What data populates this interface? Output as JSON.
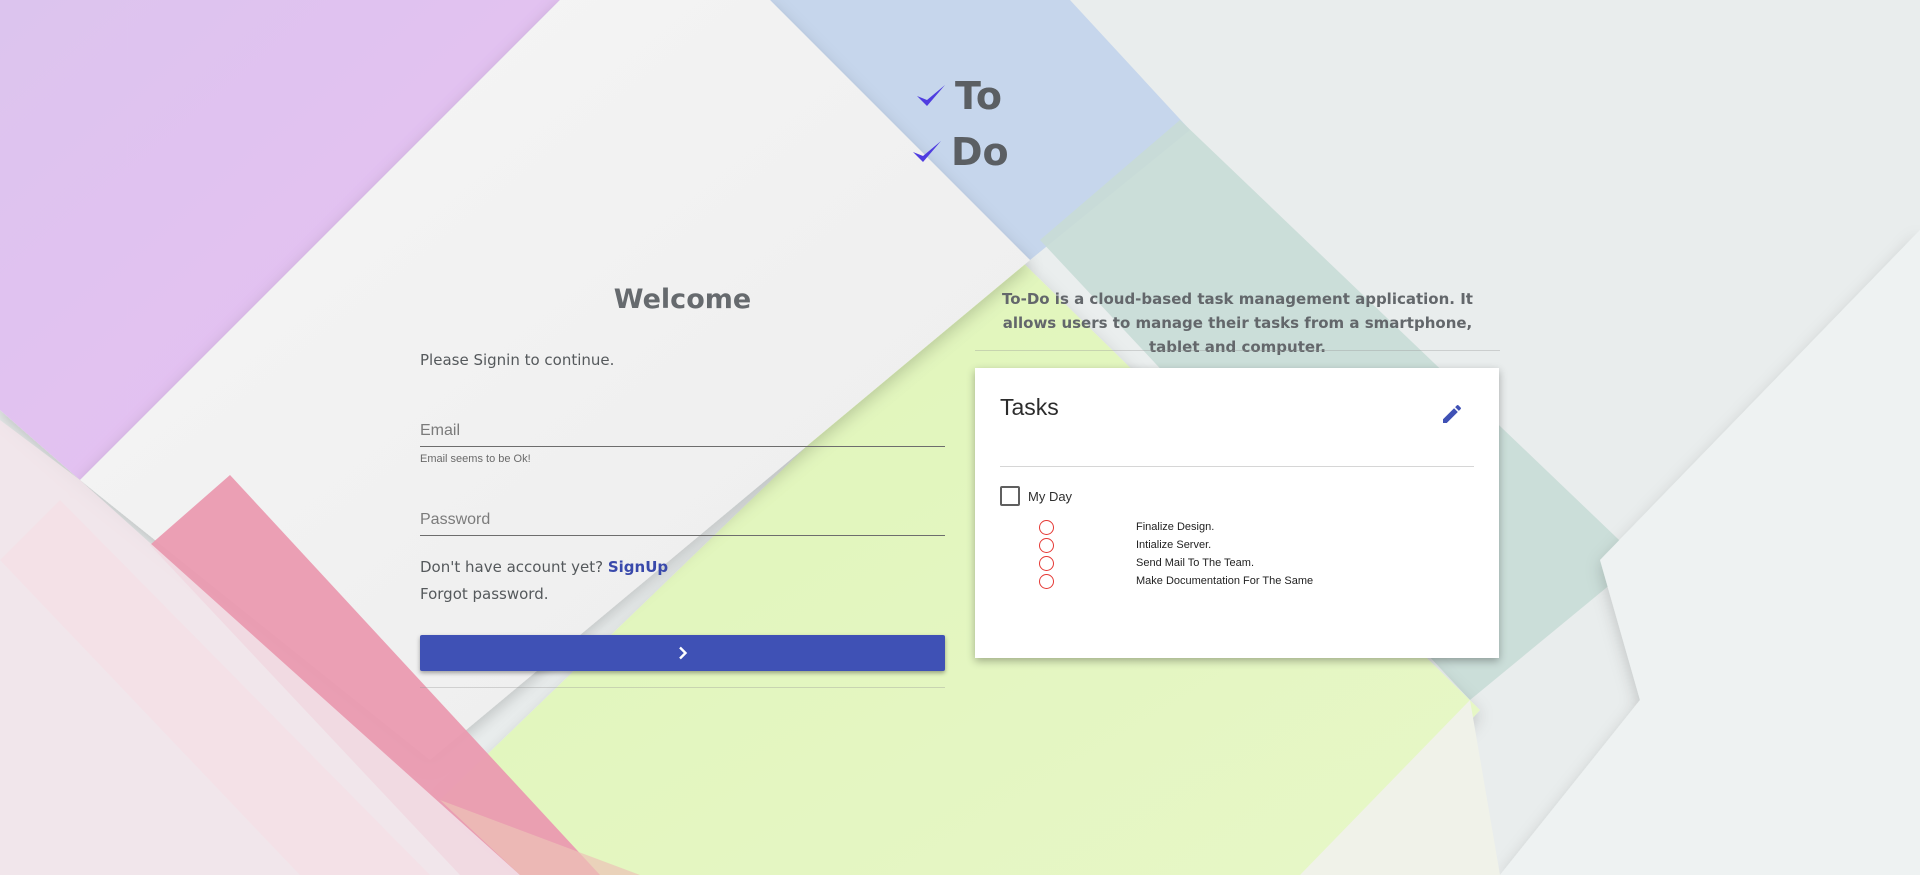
{
  "logo": {
    "line1": "To",
    "line2": "Do"
  },
  "login": {
    "title": "Welcome",
    "subtitle": "Please Signin to continue.",
    "email_placeholder": "Email",
    "email_hint": "Email seems to be Ok!",
    "password_placeholder": "Password",
    "no_account_text": "Don't have account yet?",
    "signup_link": "SignUp",
    "forgot_password": "Forgot password."
  },
  "description": "To-Do is a cloud-based task management application. It allows users to manage their tasks from a smartphone, tablet and computer.",
  "tasks_card": {
    "title": "Tasks",
    "group_label": "My Day",
    "items": [
      {
        "label": "Finalize Design."
      },
      {
        "label": "Intialize Server."
      },
      {
        "label": "Send Mail To The Team."
      },
      {
        "label": "Make Documentation For The Same"
      }
    ]
  },
  "icons": {
    "logo_check": "check-icon",
    "submit": "chevron-right-icon",
    "edit": "pencil-icon"
  },
  "colors": {
    "accent": "#3f51b5",
    "check": "#4f3de0",
    "task_radio": "#e53935"
  }
}
